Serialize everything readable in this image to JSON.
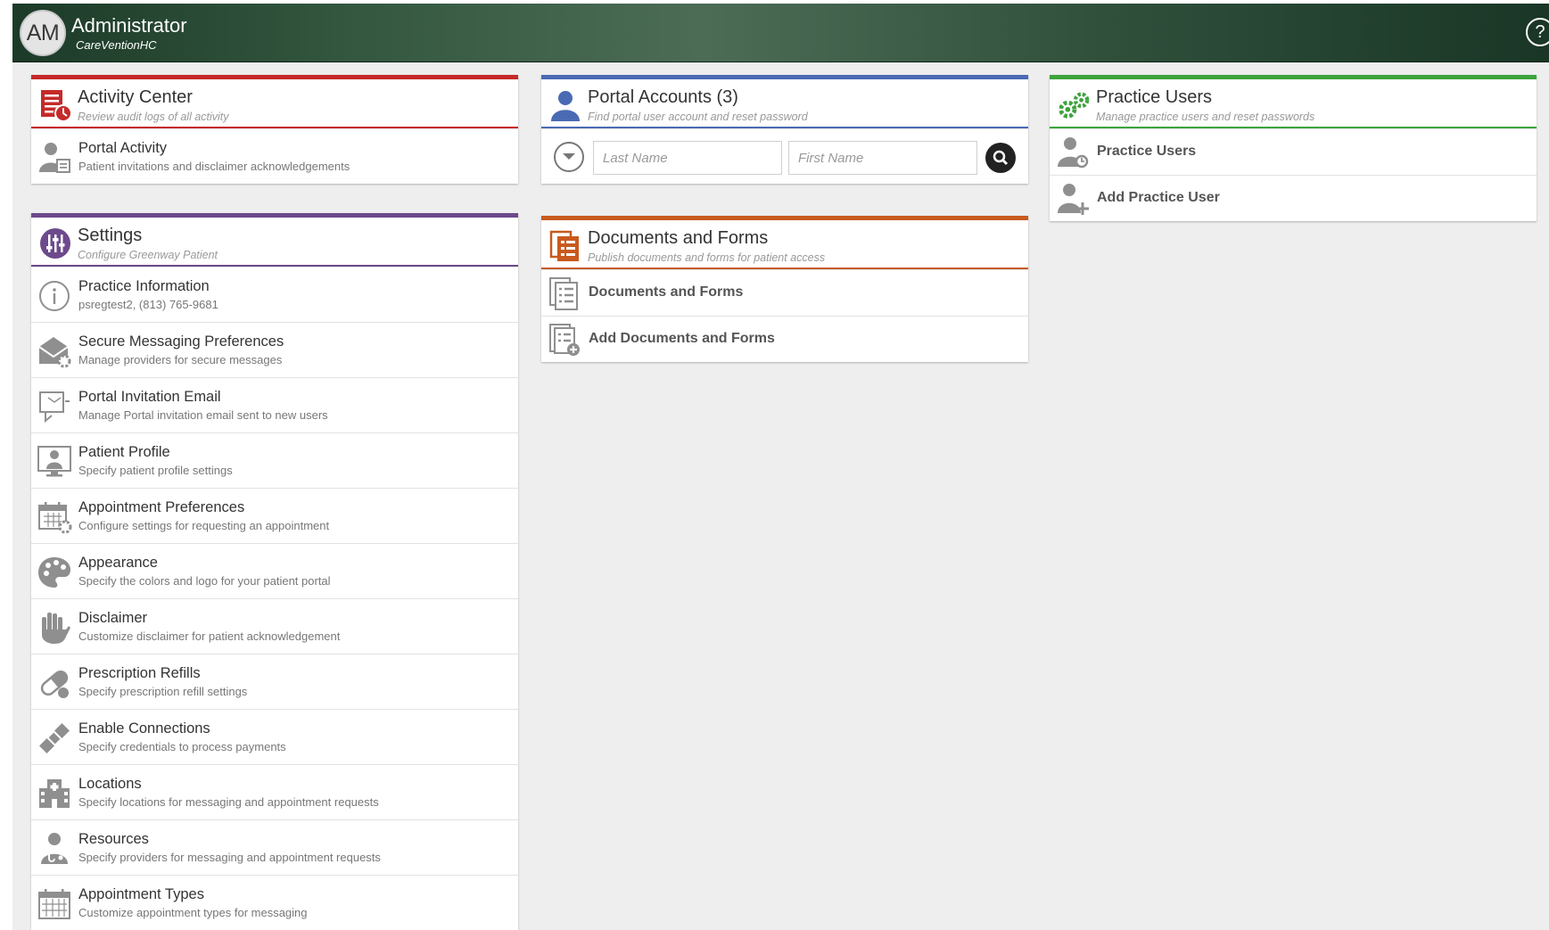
{
  "header": {
    "avatar_initials": "AM",
    "user_name": "Administrator",
    "organization": "CareVentionHC",
    "help_symbol": "?",
    "help_icon": "question-circle-icon",
    "gradient_colors": [
      "#1c3a28",
      "#4c6c56",
      "#1a3626"
    ]
  },
  "colors": {
    "activity": "#c62a2a",
    "settings": "#6c4a8c",
    "portal": "#4a6ab4",
    "documents": "#c85a1e",
    "practice": "#3da33d",
    "icon_gray": "#8f8f8f"
  },
  "activity_center": {
    "title": "Activity Center",
    "subtitle": "Review audit logs of all activity",
    "icon": "audit-log-icon",
    "items": [
      {
        "title": "Portal Activity",
        "subtitle": "Patient invitations and disclaimer acknowledgements",
        "icon": "user-log-icon"
      }
    ]
  },
  "settings": {
    "title": "Settings",
    "subtitle": "Configure Greenway Patient",
    "icon": "sliders-icon",
    "items": [
      {
        "title": "Practice Information",
        "subtitle": "psregtest2, (813) 765-9681",
        "icon": "info-icon"
      },
      {
        "title": "Secure Messaging Preferences",
        "subtitle": "Manage providers for secure messages",
        "icon": "envelope-gear-icon"
      },
      {
        "title": "Portal Invitation Email",
        "subtitle": "Manage Portal invitation email sent to new users",
        "icon": "invitation-email-icon"
      },
      {
        "title": "Patient Profile",
        "subtitle": "Specify patient profile settings",
        "icon": "patient-monitor-icon"
      },
      {
        "title": "Appointment Preferences",
        "subtitle": "Configure settings for requesting an appointment",
        "icon": "calendar-gear-icon"
      },
      {
        "title": "Appearance",
        "subtitle": "Specify the colors and logo for your patient portal",
        "icon": "palette-icon"
      },
      {
        "title": "Disclaimer",
        "subtitle": "Customize disclaimer for patient acknowledgement",
        "icon": "hand-icon"
      },
      {
        "title": "Prescription Refills",
        "subtitle": "Specify prescription refill settings",
        "icon": "pill-icon"
      },
      {
        "title": "Enable Connections",
        "subtitle": "Specify credentials to process payments",
        "icon": "plug-icon"
      },
      {
        "title": "Locations",
        "subtitle": "Specify locations for messaging and appointment requests",
        "icon": "building-icon"
      },
      {
        "title": "Resources",
        "subtitle": "Specify providers for messaging and appointment requests",
        "icon": "doctor-icon"
      },
      {
        "title": "Appointment Types",
        "subtitle": "Customize appointment types for messaging",
        "icon": "calendar-icon"
      }
    ]
  },
  "portal_accounts": {
    "title": "Portal Accounts (3)",
    "subtitle": "Find portal user account and reset password",
    "icon": "user-icon",
    "last_name_placeholder": "Last Name",
    "first_name_placeholder": "First Name",
    "last_name_value": "",
    "first_name_value": "",
    "expand_icon": "chevron-down-icon",
    "search_icon": "search-icon"
  },
  "documents_forms": {
    "title": "Documents and Forms",
    "subtitle": "Publish documents and forms for patient access",
    "icon": "documents-icon",
    "items": [
      {
        "title": "Documents and Forms",
        "icon": "document-list-icon"
      },
      {
        "title": "Add Documents and Forms",
        "icon": "document-add-icon"
      }
    ]
  },
  "practice_users": {
    "title": "Practice Users",
    "subtitle": "Manage practice users and reset passwords",
    "icon": "gears-icon",
    "items": [
      {
        "title": "Practice Users",
        "icon": "user-refresh-icon"
      },
      {
        "title": "Add Practice User",
        "icon": "user-add-icon"
      }
    ]
  }
}
